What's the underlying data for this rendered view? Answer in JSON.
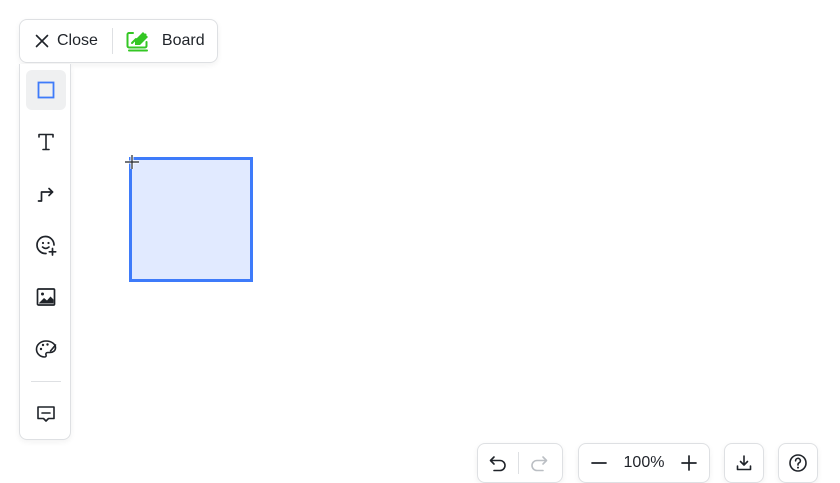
{
  "topbar": {
    "close_label": "Close",
    "board_label": "Board"
  },
  "tools": [
    {
      "name": "rectangle-tool",
      "icon": "square-icon",
      "active": true
    },
    {
      "name": "text-tool",
      "icon": "text-icon"
    },
    {
      "name": "connector-tool",
      "icon": "connector-arrow-icon"
    },
    {
      "name": "sticker-tool",
      "icon": "emoji-add-icon"
    },
    {
      "name": "image-tool",
      "icon": "image-icon"
    },
    {
      "name": "style-tool",
      "icon": "palette-icon"
    },
    {
      "name": "comment-tool",
      "icon": "comment-icon"
    }
  ],
  "zoom": {
    "value": "100%"
  },
  "colors": {
    "accent": "#3e7bfa",
    "shape_fill": "#e1eaff",
    "board_icon": "#34c724",
    "icon": "#1f2329",
    "disabled_icon": "#bbbfc4"
  }
}
